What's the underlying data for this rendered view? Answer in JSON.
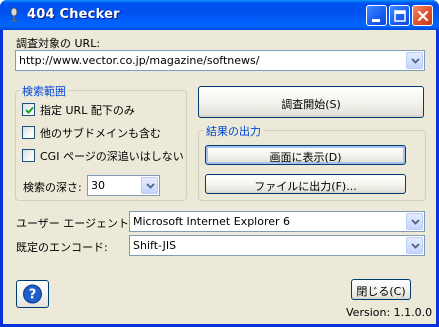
{
  "window": {
    "title": "404 Checker"
  },
  "url_section": {
    "label": "調査対象の URL:",
    "value": "http://www.vector.co.jp/magazine/softnews/"
  },
  "search_range": {
    "title": "検索範囲",
    "options": [
      {
        "label": "指定 URL 配下のみ",
        "checked": true
      },
      {
        "label": "他のサブドメインも含む",
        "checked": false
      },
      {
        "label": "CGI ページの深追いはしない",
        "checked": false
      }
    ],
    "depth_label": "検索の深さ:",
    "depth_value": "30"
  },
  "start_button": {
    "label": "調査開始(S)"
  },
  "output": {
    "title": "結果の出力",
    "screen_button": "画面に表示(D)",
    "file_button": "ファイルに出力(F)..."
  },
  "user_agent": {
    "label": "ユーザー エージェント:",
    "value": "Microsoft Internet Explorer 6"
  },
  "encoding": {
    "label": "既定のエンコード:",
    "value": "Shift-JIS"
  },
  "footer": {
    "close_button": "閉じる(C)",
    "version": "Version: 1.1.0.0"
  },
  "colors": {
    "titlebar": "#0054e3",
    "group_title": "#0046d5",
    "face": "#ece9d8"
  },
  "icons": [
    "microphone-icon",
    "minimize-icon",
    "maximize-icon",
    "close-icon",
    "help-icon",
    "chevron-down-icon",
    "checkmark-icon"
  ]
}
